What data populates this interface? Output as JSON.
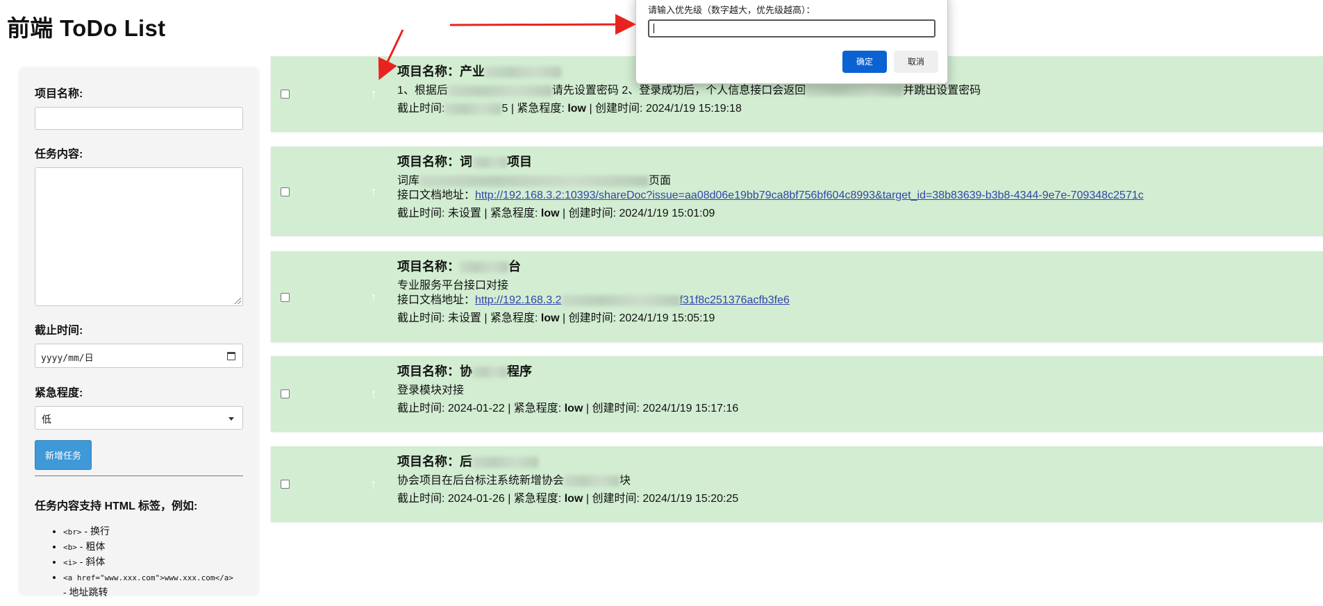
{
  "page": {
    "title": "前端 ToDo List"
  },
  "form": {
    "project_label": "项目名称:",
    "project_value": "",
    "content_label": "任务内容:",
    "content_value": "",
    "deadline_label": "截止时间:",
    "deadline_placeholder": "yyyy/mm/日",
    "urgency_label": "紧急程度:",
    "urgency_selected": "低",
    "add_button": "新增任务",
    "help_title": "任务内容支持 HTML 标签，例如:",
    "help_items": [
      {
        "code": "<br>",
        "desc": " - 换行"
      },
      {
        "code": "<b>",
        "desc": " - 粗体"
      },
      {
        "code": "<i>",
        "desc": " - 斜体"
      },
      {
        "code": "<a href=\"www.xxx.com\">www.xxx.com</a>",
        "desc": " - 地址跳转"
      }
    ]
  },
  "tasks": [
    {
      "title": "项目名称：产业",
      "line1": "1、根据后",
      "line1_tail": "请先设置密码 2、登录成功后，个人信息接口会返回",
      "line1_end": "并跳出设置密码",
      "meta_deadline": "截止时间:",
      "meta_deadline_tail": "5",
      "meta_urgency_label": "| 紧急程度:",
      "meta_urgency": "low",
      "meta_created": "| 创建时间: 2024/1/19 15:19:18"
    },
    {
      "title": "项目名称：词",
      "title_tail": "项目",
      "line1": "词库",
      "line1_end": "页面",
      "line2_label": "接口文档地址：",
      "line2_link": "http://192.168.3.2:10393/shareDoc?issue=aa08d06e19bb79ca8bf756bf604c8993&target_id=38b83639-b3b8-4344-9e7e-709348c2571c",
      "meta_deadline": "截止时间: 未设置",
      "meta_urgency_label": "| 紧急程度:",
      "meta_urgency": "low",
      "meta_created": "| 创建时间: 2024/1/19 15:01:09"
    },
    {
      "title": "项目名称：",
      "title_tail": "台",
      "line1": "专业服务平台接口对接",
      "line2_label": "接口文档地址：",
      "line2_link": "http://192.168.3.2",
      "line2_link_tail": "f31f8c251376acfb3fe6",
      "meta_deadline": "截止时间: 未设置",
      "meta_urgency_label": "| 紧急程度:",
      "meta_urgency": "low",
      "meta_created": "| 创建时间: 2024/1/19 15:05:19"
    },
    {
      "title": "项目名称：协",
      "title_tail": "程序",
      "line1": "登录模块对接",
      "meta_deadline": "截止时间: 2024-01-22",
      "meta_urgency_label": "| 紧急程度:",
      "meta_urgency": "low",
      "meta_created": "| 创建时间: 2024/1/19 15:17:16"
    },
    {
      "title": "项目名称：后",
      "line1": "协会项目在后台标注系统新增协会",
      "line1_end": "块",
      "meta_deadline": "截止时间: 2024-01-26",
      "meta_urgency_label": "| 紧急程度:",
      "meta_urgency": "low",
      "meta_created": "| 创建时间: 2024/1/19 15:20:25"
    }
  ],
  "dialog": {
    "message": "请输入优先级（数字越大，优先级越高）：",
    "input_value": "",
    "ok": "确定",
    "cancel": "取消"
  },
  "colors": {
    "task_bg": "#d2edd2",
    "primary_button": "#3f98d8",
    "dialog_ok": "#0b62d3",
    "annotation_arrow": "#e8231f"
  },
  "icons": {
    "priority": "arrow-up-icon",
    "calendar": "calendar-icon",
    "dropdown": "chevron-down-icon"
  }
}
